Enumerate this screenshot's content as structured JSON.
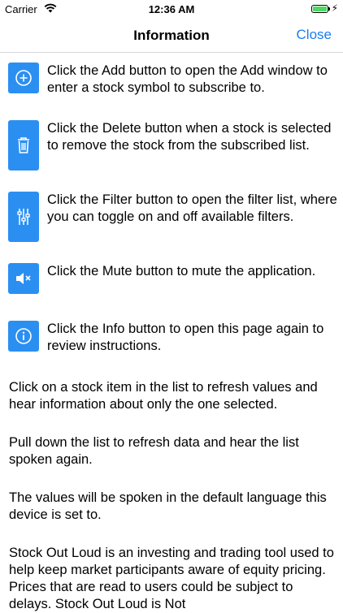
{
  "status_bar": {
    "carrier": "Carrier",
    "time": "12:36 AM",
    "battery_level": 1.0
  },
  "nav": {
    "title": "Information",
    "close_label": "Close"
  },
  "instructions": [
    {
      "icon": "add-icon",
      "text": "Click the Add button to open the Add window to enter a stock symbol to subscribe to."
    },
    {
      "icon": "trash-icon",
      "text": "Click the Delete button when a stock is selected to remove the stock from the subscribed list."
    },
    {
      "icon": "filter-icon",
      "text": "Click the Filter button to open the filter list, where you can toggle on and off available filters."
    },
    {
      "icon": "mute-icon",
      "text": "Click the Mute button to mute the application."
    },
    {
      "icon": "info-icon",
      "text": "Click the Info button to open this page again to review instructions."
    }
  ],
  "paragraphs": [
    "Click on a stock item in the list to refresh values and hear information about only the one selected.",
    "Pull down the list to refresh data and hear the list spoken again.",
    "The values will be spoken in the default language this device is set to.",
    "Stock Out Loud is an investing and trading tool used to help keep market participants aware of equity pricing. Prices that are read to users could be subject to delays. Stock Out Loud is Not"
  ],
  "colors": {
    "accent": "#1a7df0",
    "icon_bg": "#2b8ff2",
    "battery": "#4cd964"
  }
}
